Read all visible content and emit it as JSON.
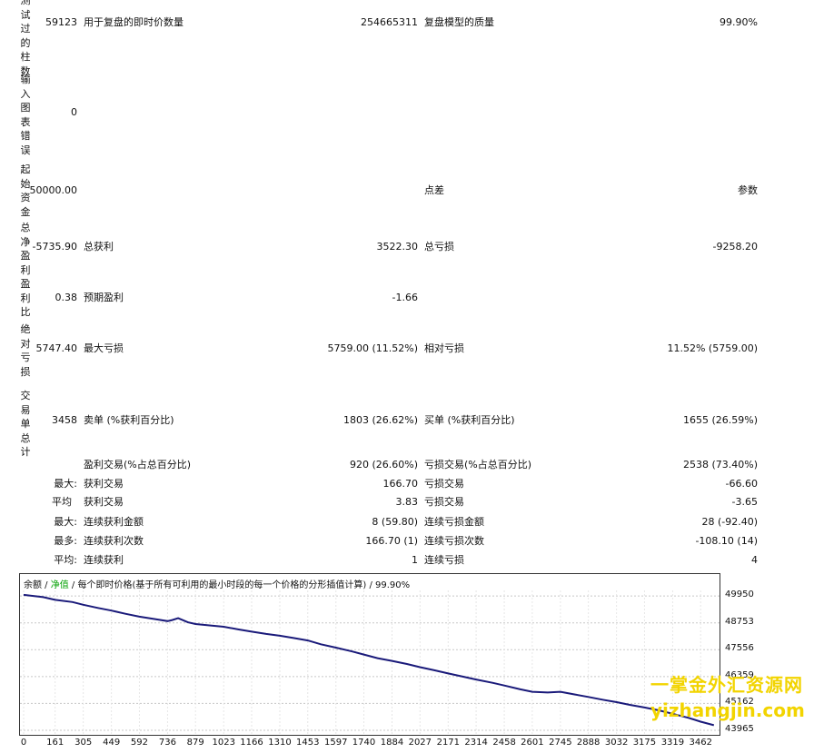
{
  "summary": {
    "bars_tested": {
      "label": "测试过的柱数",
      "value": "59123"
    },
    "ticks_label": "用于复盘的即时价数量",
    "ticks_value": "254665311",
    "quality_label": "复盘模型的质量",
    "quality_value": "99.90%",
    "chart_errors": {
      "label": "输入图表错误",
      "value": "0"
    },
    "initial_deposit": {
      "label": "起始资金",
      "value": "50000.00"
    },
    "spread_label": "点差",
    "spread_value": "参数",
    "net_profit": {
      "label": "总净盈利",
      "value": "-5735.90"
    },
    "gross_profit_label": "总获利",
    "gross_profit_value": "3522.30",
    "gross_loss_label": "总亏损",
    "gross_loss_value": "-9258.20",
    "profit_factor": {
      "label": "盈利比",
      "value": "0.38"
    },
    "expected_payoff_label": "预期盈利",
    "expected_payoff_value": "-1.66",
    "abs_drawdown": {
      "label": "绝对亏损",
      "value": "5747.40"
    },
    "max_drawdown_label": "最大亏损",
    "max_drawdown_value": "5759.00 (11.52%)",
    "rel_drawdown_label": "相对亏损",
    "rel_drawdown_value": "11.52% (5759.00)",
    "total_trades": {
      "label": "交易单总计",
      "value": "3458"
    },
    "short_label": "卖单 (%获利百分比)",
    "short_value": "1803 (26.62%)",
    "long_label": "买单 (%获利百分比)",
    "long_value": "1655 (26.59%)",
    "profit_trades_label": "盈利交易(%占总百分比)",
    "profit_trades_value": "920 (26.60%)",
    "loss_trades_label": "亏损交易(%占总百分比)",
    "loss_trades_value": "2538 (73.40%)",
    "rows": [
      {
        "prefix": "最大:",
        "l_label": "获利交易",
        "l_value": "166.70",
        "r_label": "亏损交易",
        "r_value": "-66.60"
      },
      {
        "prefix": "平均",
        "l_label": "获利交易",
        "l_value": "3.83",
        "r_label": "亏损交易",
        "r_value": "-3.65"
      },
      {
        "prefix": "最大:",
        "l_label": "连续获利金额",
        "l_value": "8 (59.80)",
        "r_label": "连续亏损金额",
        "r_value": "28 (-92.40)"
      },
      {
        "prefix": "最多:",
        "l_label": "连续获利次数",
        "l_value": "166.70 (1)",
        "r_label": "连续亏损次数",
        "r_value": "-108.10 (14)"
      },
      {
        "prefix": "平均:",
        "l_label": "连续获利",
        "l_value": "1",
        "r_label": "连续亏损",
        "r_value": "4"
      }
    ]
  },
  "chart_legend": {
    "balance": "余额",
    "sep1": " / ",
    "equity": "净值",
    "rest": " / 每个即时价格(基于所有可利用的最小时段的每一个价格的分形插值计算) / 99.90%"
  },
  "watermark": {
    "line1": "一掌金外汇资源网",
    "line2": "yizhangjin.com"
  },
  "colors": {
    "line": "#1a1a7a",
    "equity_label": "#00a000",
    "grid": "#c8c8c8",
    "watermark": "#f2d400"
  },
  "chart_data": {
    "type": "line",
    "y_ticks": [
      49950,
      48753,
      47556,
      46359,
      45162,
      43965
    ],
    "x_ticks": [
      0,
      161,
      305,
      449,
      592,
      736,
      879,
      1023,
      1166,
      1310,
      1453,
      1597,
      1740,
      1884,
      2027,
      2171,
      2314,
      2458,
      2601,
      2745,
      2888,
      3032,
      3175,
      3319,
      3462
    ],
    "ylim": [
      43965,
      50200
    ],
    "xlim": [
      0,
      3540
    ],
    "series": [
      {
        "x": [
          0,
          100,
          161,
          250,
          305,
          380,
          449,
          520,
          592,
          680,
          736,
          760,
          790,
          840,
          879,
          950,
          1023,
          1100,
          1166,
          1240,
          1310,
          1380,
          1453,
          1520,
          1597,
          1680,
          1740,
          1810,
          1884,
          1960,
          2027,
          2100,
          2171,
          2240,
          2314,
          2400,
          2458,
          2540,
          2601,
          2680,
          2745,
          2820,
          2888,
          2960,
          3032,
          3100,
          3175,
          3250,
          3319,
          3400,
          3462,
          3530
        ],
        "y": [
          50000,
          49900,
          49780,
          49680,
          49560,
          49420,
          49300,
          49160,
          49030,
          48910,
          48830,
          48880,
          48960,
          48780,
          48700,
          48640,
          48580,
          48460,
          48360,
          48260,
          48180,
          48080,
          47970,
          47800,
          47650,
          47480,
          47340,
          47180,
          47060,
          46920,
          46780,
          46640,
          46500,
          46370,
          46230,
          46080,
          45960,
          45790,
          45680,
          45650,
          45680,
          45560,
          45450,
          45330,
          45220,
          45100,
          44980,
          44850,
          44700,
          44520,
          44350,
          44190
        ]
      }
    ]
  }
}
